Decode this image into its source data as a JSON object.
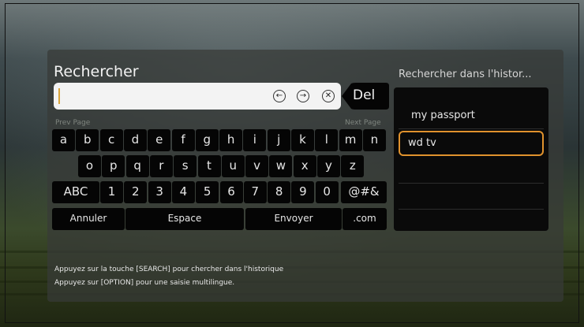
{
  "search": {
    "title": "Rechercher",
    "value": ""
  },
  "controls": {
    "back": "←",
    "forward": "→",
    "clear": "✕",
    "del": "Del"
  },
  "pagination": {
    "prev": "Prev Page",
    "next": "Next Page"
  },
  "keyboard": {
    "row1": [
      "a",
      "b",
      "c",
      "d",
      "e",
      "f",
      "g",
      "h",
      "i",
      "j",
      "k",
      "l",
      "m",
      "n"
    ],
    "row2": [
      "o",
      "p",
      "q",
      "r",
      "s",
      "t",
      "u",
      "v",
      "w",
      "x",
      "y",
      "z"
    ],
    "row3": [
      "ABC",
      "1",
      "2",
      "3",
      "4",
      "5",
      "6",
      "7",
      "8",
      "9",
      "0",
      "@#&"
    ],
    "row4": [
      "Annuler",
      "Espace",
      "Envoyer",
      ".com"
    ]
  },
  "history": {
    "title": "Rechercher dans l'histor...",
    "items": [
      "my passport",
      "wd tv"
    ],
    "selected_index": 1
  },
  "help": {
    "line1": "Appuyez sur la touche [SEARCH] pour chercher dans l'historique",
    "line2": "Appuyez sur [OPTION] pour une saisie multilingue."
  },
  "colors": {
    "accent": "#e0922d",
    "caret": "#d9a53b",
    "key_bg": "#050505",
    "panel_bg": "#373a37"
  }
}
